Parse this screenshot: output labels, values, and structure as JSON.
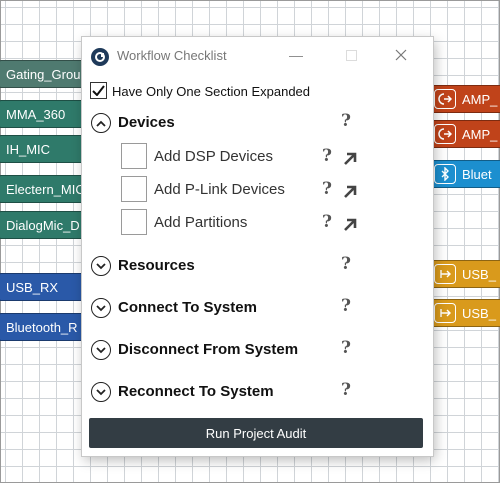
{
  "window": {
    "title": "Workflow Checklist",
    "minimize_glyph": "—",
    "maximize_glyph": "☐",
    "close_glyph": "✕"
  },
  "option": {
    "label": "Have Only One Section Expanded",
    "checked": true
  },
  "help_glyph": "?",
  "sections": [
    {
      "label": "Devices",
      "expanded": true,
      "icon": "chevron-up-icon"
    },
    {
      "label": "Resources",
      "expanded": false,
      "icon": "chevron-down-icon"
    },
    {
      "label": "Connect To System",
      "expanded": false,
      "icon": "chevron-down-icon"
    },
    {
      "label": "Disconnect From System",
      "expanded": false,
      "icon": "chevron-down-icon"
    },
    {
      "label": "Reconnect To System",
      "expanded": false,
      "icon": "chevron-down-icon"
    }
  ],
  "devices_items": [
    {
      "label": "Add DSP Devices",
      "checked": false
    },
    {
      "label": "Add P-Link Devices",
      "checked": false
    },
    {
      "label": "Add Partitions",
      "checked": false
    }
  ],
  "run_button": {
    "label": "Run Project Audit"
  },
  "background_nodes": {
    "left": [
      {
        "label": "Gating_Grou",
        "color": "#4f7a70"
      },
      {
        "label": "MMA_360",
        "color": "#2f7a6a"
      },
      {
        "label": "IH_MIC",
        "color": "#2f7a6a"
      },
      {
        "label": "Electern_MIC",
        "color": "#2f7a6a"
      },
      {
        "label": "DialogMic_D",
        "color": "#2f7a6a"
      },
      {
        "label": "USB_RX",
        "color": "#2a59a8"
      },
      {
        "label": "Bluetooth_R",
        "color": "#2a59a8"
      }
    ],
    "right": [
      {
        "label": "AMP_",
        "color": "#c0431a",
        "icon": "output-icon"
      },
      {
        "label": "AMP_",
        "color": "#c0431a",
        "icon": "output-icon"
      },
      {
        "label": "Bluet",
        "color": "#1c8fcf",
        "icon": "bluetooth-icon"
      },
      {
        "label": "USB_",
        "color": "#d99a1c",
        "icon": "usb-icon"
      },
      {
        "label": "USB_",
        "color": "#d99a1c",
        "icon": "usb-icon"
      }
    ]
  }
}
